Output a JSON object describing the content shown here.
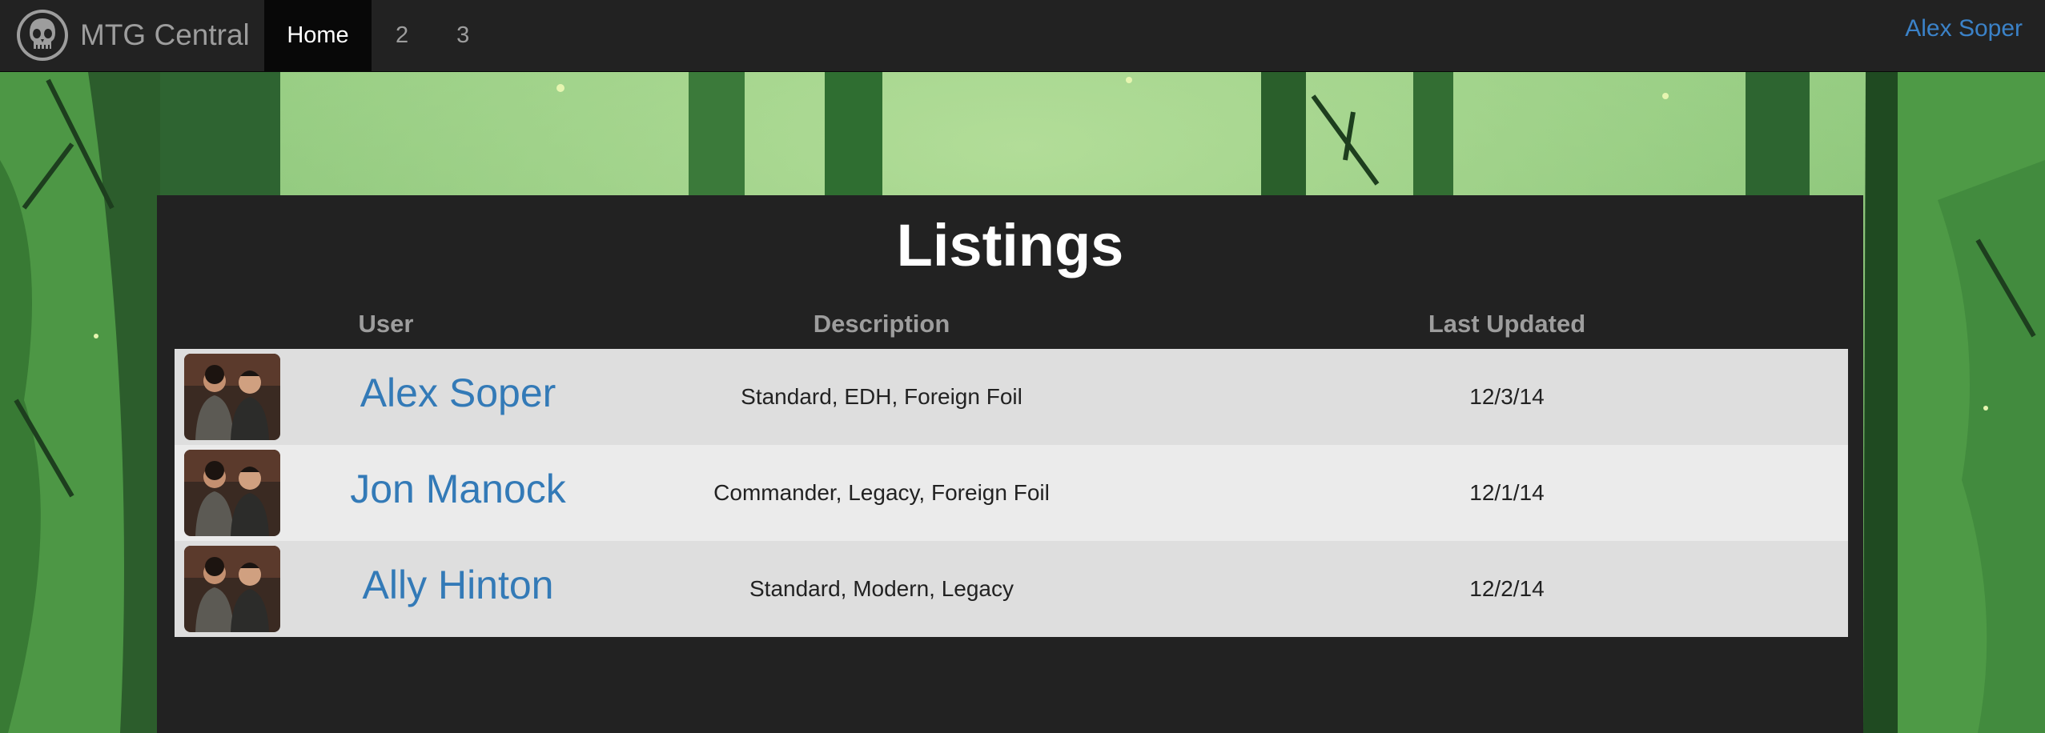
{
  "navbar": {
    "brand": "MTG Central",
    "items": [
      {
        "label": "Home",
        "active": true
      },
      {
        "label": "2",
        "active": false
      },
      {
        "label": "3",
        "active": false
      }
    ],
    "user": "Alex Soper"
  },
  "main": {
    "title": "Listings",
    "columns": [
      "User",
      "Description",
      "Last Updated"
    ],
    "rows": [
      {
        "user": "Alex Soper",
        "description": "Standard, EDH, Foreign Foil",
        "updated": "12/3/14"
      },
      {
        "user": "Jon Manock",
        "description": "Commander, Legacy, Foreign Foil",
        "updated": "12/1/14"
      },
      {
        "user": "Ally Hinton",
        "description": "Standard, Modern, Legacy",
        "updated": "12/2/14"
      }
    ]
  },
  "colors": {
    "navbar_bg": "#222222",
    "active_tab_bg": "#080808",
    "link_blue": "#337ab7",
    "background_green": "#5fa85a"
  },
  "icons": {
    "brand": "skull-icon",
    "avatar": "user-photo"
  }
}
